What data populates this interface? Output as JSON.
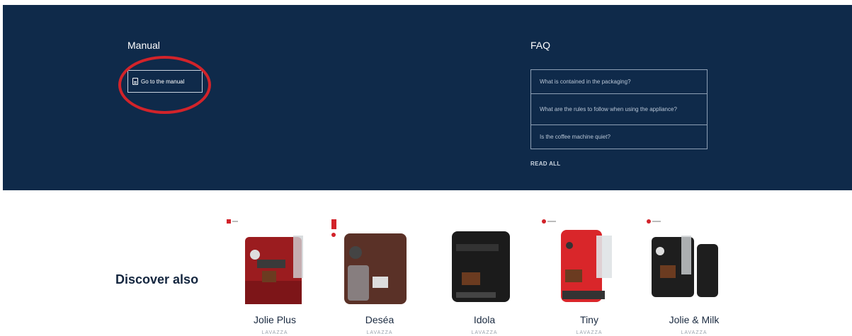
{
  "manual": {
    "title": "Manual",
    "button_label": "Go to the manual",
    "icon": "document-icon"
  },
  "faq": {
    "title": "FAQ",
    "items": [
      "What is contained in the packaging?",
      "What are the rules to follow when using the appliance?",
      "Is the coffee machine quiet?"
    ],
    "read_all": "READ ALL"
  },
  "discover": {
    "title": "Discover also",
    "products": [
      {
        "name": "Jolie Plus",
        "brand": "LAVAZZA",
        "color": "#9b1c1f"
      },
      {
        "name": "Deséa",
        "brand": "LAVAZZA",
        "color": "#5a3127"
      },
      {
        "name": "Idola",
        "brand": "LAVAZZA",
        "color": "#1b1b1b"
      },
      {
        "name": "Tiny",
        "brand": "LAVAZZA",
        "color": "#d9262a"
      },
      {
        "name": "Jolie & Milk",
        "brand": "LAVAZZA",
        "color": "#1e1e1e"
      }
    ]
  },
  "colors": {
    "panel": "#0f2a4a",
    "highlight": "#d2232a"
  }
}
